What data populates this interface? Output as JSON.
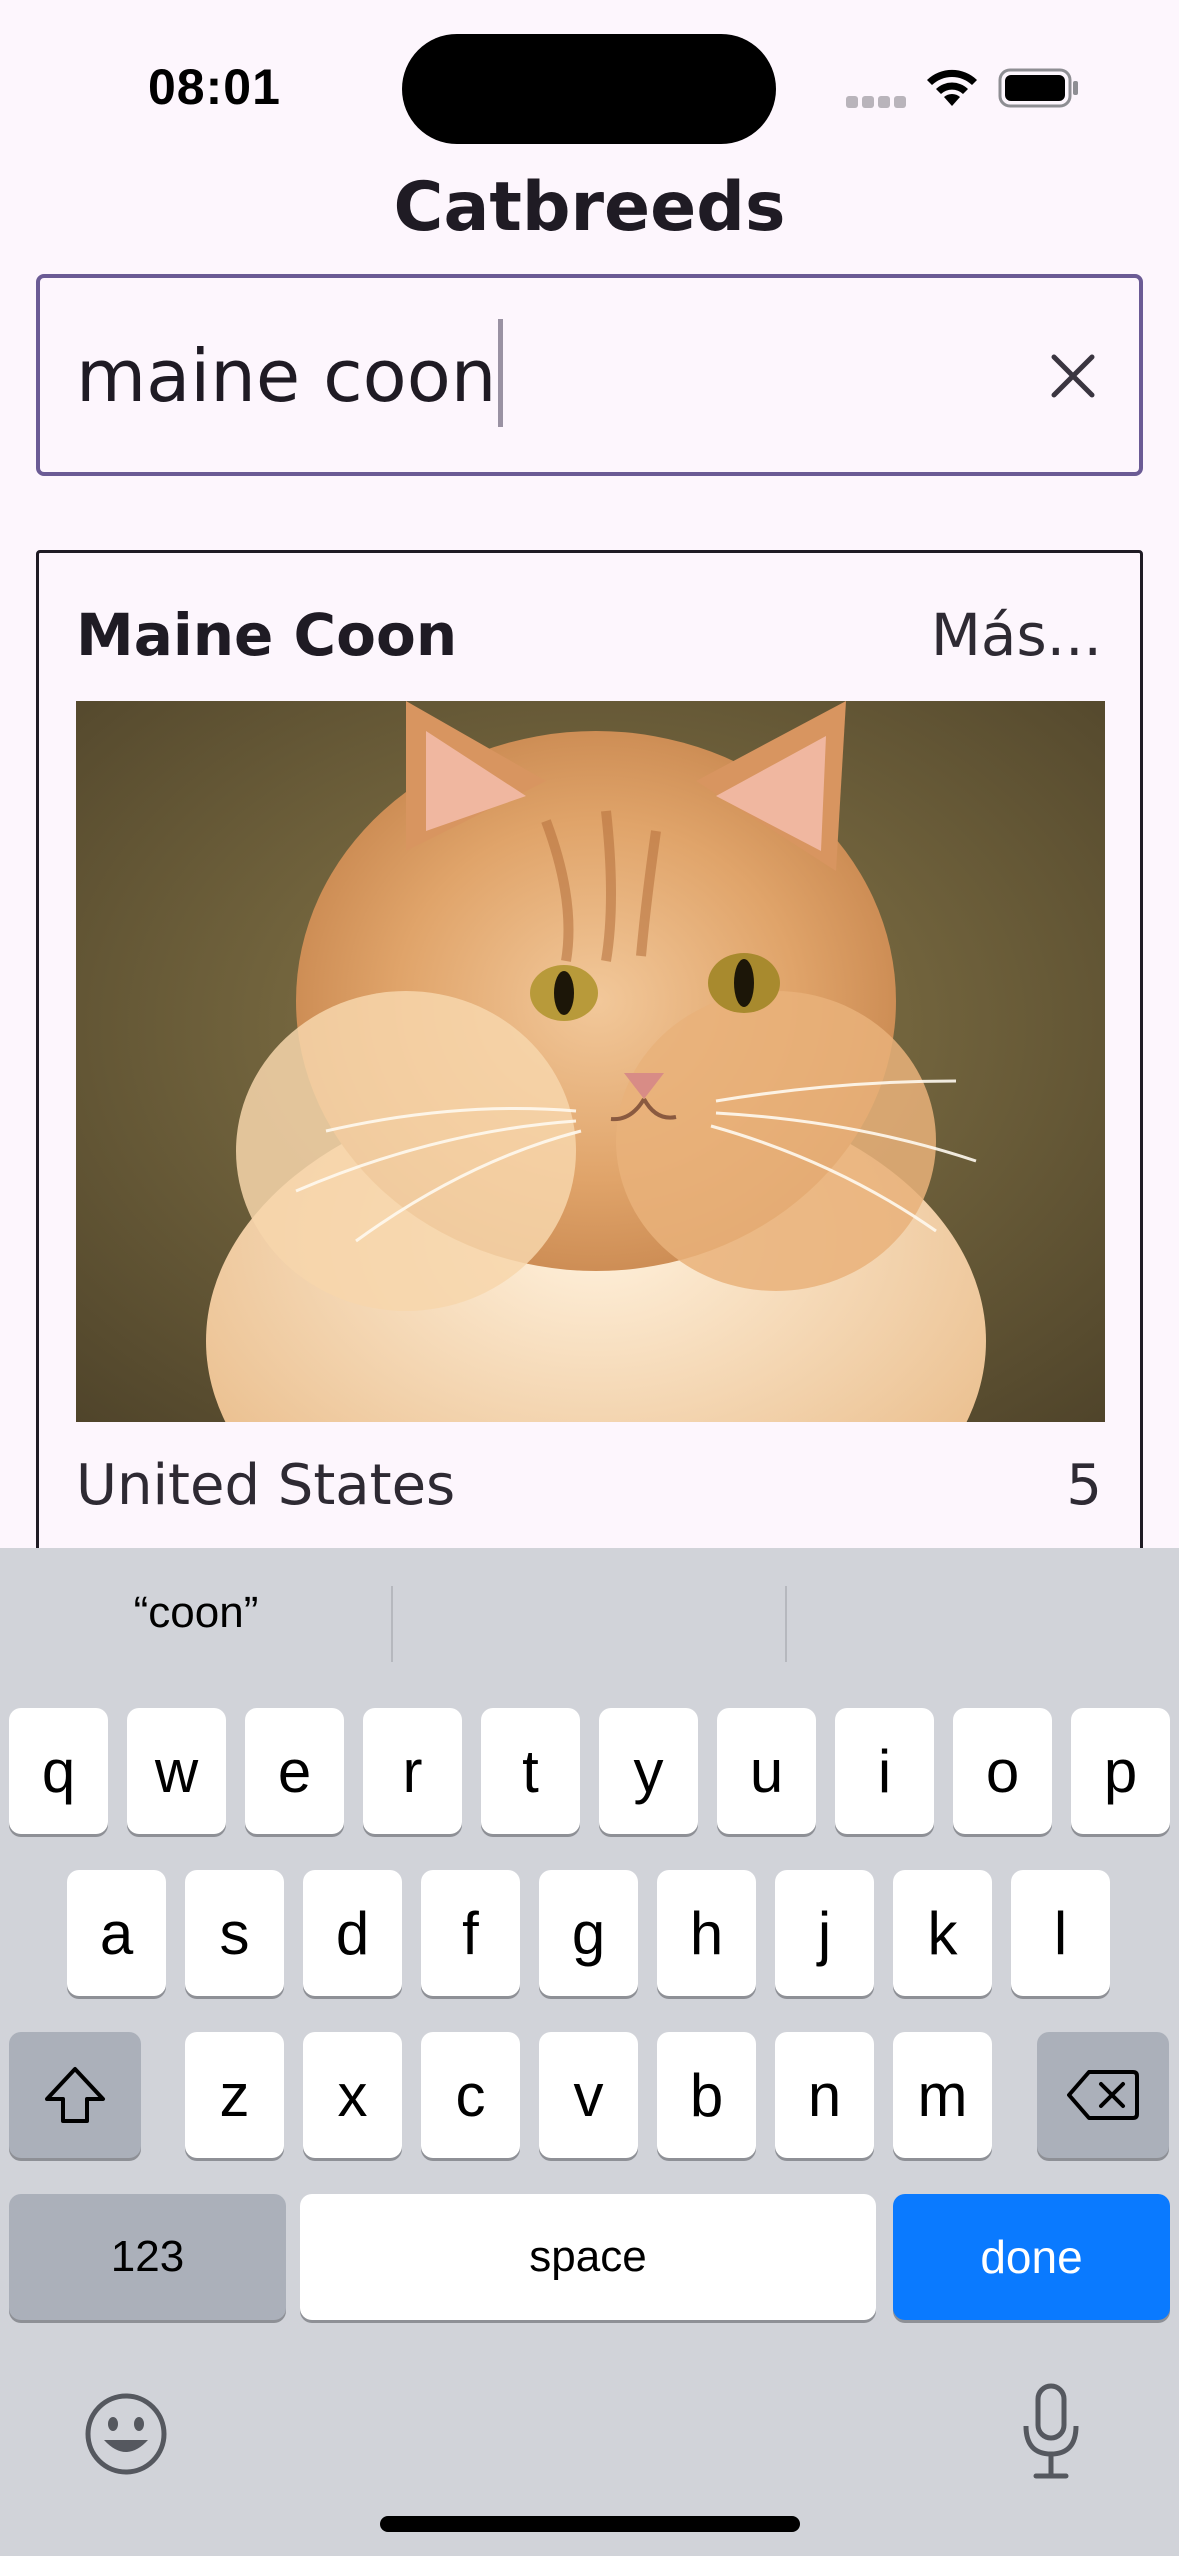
{
  "status_bar": {
    "time": "08:01"
  },
  "header": {
    "title": "Catbreeds"
  },
  "search": {
    "value": "maine coon"
  },
  "card": {
    "name": "Maine Coon",
    "more_label": "Más...",
    "origin": "United States",
    "rating": "5",
    "image_description": "orange long-haired Maine Coon cat"
  },
  "keyboard": {
    "suggestions": [
      "“coon”",
      "",
      ""
    ],
    "row1": [
      "q",
      "w",
      "e",
      "r",
      "t",
      "y",
      "u",
      "i",
      "o",
      "p"
    ],
    "row2": [
      "a",
      "s",
      "d",
      "f",
      "g",
      "h",
      "j",
      "k",
      "l"
    ],
    "row3": [
      "z",
      "x",
      "c",
      "v",
      "b",
      "n",
      "m"
    ],
    "numbers_label": "123",
    "space_label": "space",
    "done_label": "done"
  },
  "colors": {
    "background": "#fdf6fd",
    "search_border": "#6b5b95",
    "keyboard_bg": "#d1d3d9",
    "done_key": "#0a7aff"
  }
}
